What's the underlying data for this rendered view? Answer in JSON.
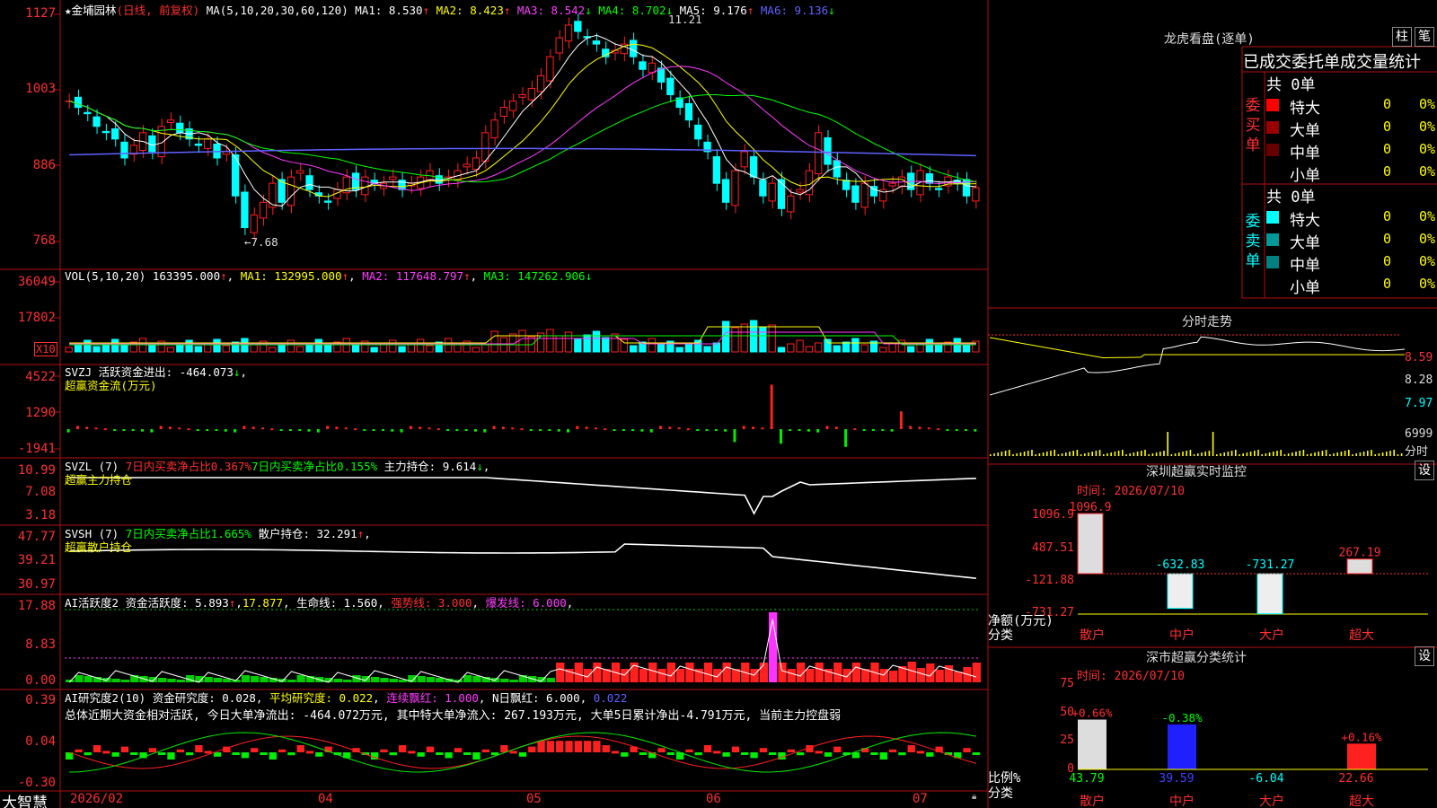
{
  "stock": {
    "name": "金埔园林",
    "mode": "(日线, 前复权)",
    "star": "★"
  },
  "ma_header": {
    "label": "MA(5,10,20,30,60,120)",
    "items": [
      {
        "name": "MA1:",
        "value": "8.530",
        "color": "#ffffff",
        "arrow": "↑",
        "arrow_color": "#ff3030"
      },
      {
        "name": "MA2:",
        "value": "8.423",
        "color": "#ffff00",
        "arrow": "↑",
        "arrow_color": "#ff3030"
      },
      {
        "name": "MA3:",
        "value": "8.542",
        "color": "#ff3cff",
        "arrow": "↓",
        "arrow_color": "#00ff00"
      },
      {
        "name": "MA4:",
        "value": "8.702",
        "color": "#00ff00",
        "arrow": "↓",
        "arrow_color": "#00ff00"
      },
      {
        "name": "MA5:",
        "value": "9.176",
        "color": "#ffffff",
        "arrow": "↑",
        "arrow_color": "#ff3030"
      },
      {
        "name": "MA6:",
        "value": "9.136",
        "color": "#6060ff",
        "arrow": "↓",
        "arrow_color": "#00ff00"
      }
    ]
  },
  "price_axis": [
    "1127",
    "1003",
    "886",
    "768"
  ],
  "price_annotations": {
    "high": "11.21",
    "low": "←7.68"
  },
  "vol": {
    "label": "VOL(5,10,20)",
    "value": "163395.000",
    "ma1": "MA1: 132995.000",
    "ma2": "MA2: 117648.797",
    "ma3": "MA3: 147262.906",
    "axis": [
      "36049",
      "17802"
    ],
    "unit": "X10"
  },
  "svzj": {
    "label": "SVZJ",
    "desc": "活跃资金进出: -464.073",
    "sub": "超赢资金流(万元)",
    "axis": [
      "4522",
      "1290",
      "-1941"
    ]
  },
  "svzl": {
    "label": "SVZL (7)",
    "t1": "7日内买卖净占比0.367%",
    "t2": "7日内买卖净占比0.155%",
    "t3": "主力持仓: 9.614",
    "sub": "超赢主力持仓",
    "axis": [
      "10.99",
      "7.08",
      "3.18"
    ]
  },
  "svsh": {
    "label": "SVSH (7)",
    "t1": "7日内买卖净占比1.665%",
    "t2": "散户持仓: 32.291",
    "sub": "超赢散户持仓",
    "axis": [
      "47.77",
      "39.21",
      "30.97"
    ]
  },
  "ai1": {
    "label": "AI活跃度2",
    "t1": "资金活跃度: 5.893",
    "t2": "17.877",
    "t3": "生命线: 1.560",
    "t4": "强势线: 3.000",
    "t5": "爆发线: 6.000",
    "axis": [
      "17.88",
      "8.83",
      "0.00"
    ]
  },
  "ai2": {
    "label": "AI研究度2(10)",
    "t1": "资金研究度: 0.028",
    "t2": "平均研究度: 0.022",
    "t3": "连续飘红: 1.000",
    "t4": "N日飘红: 6.000",
    "t5": "0.022",
    "summary": "总体近期大资金相对活跃, 今日大单净流出: -464.072万元, 其中特大单净流入: 267.193万元, 大单5日累计净出-4.791万元, 当前主力控盘弱",
    "axis": [
      "0.39",
      "0.04",
      "-0.30"
    ]
  },
  "time_axis": [
    "2026/02",
    "04",
    "05",
    "06",
    "07"
  ],
  "brand": "大智慧",
  "dragon": {
    "title": "龙虎看盘(逐单)",
    "btn1": "柱",
    "btn2": "笔",
    "tabs": "已成交委托单成交量统计",
    "buy_label": "委买单",
    "sell_label": "委卖单",
    "buy_total": "共 0单",
    "sell_total": "共 0单",
    "buy_rows": [
      {
        "name": "特大",
        "count": "0",
        "pct": "0%",
        "color": "#ff0000"
      },
      {
        "name": "大单",
        "count": "0",
        "pct": "0%",
        "color": "#990000"
      },
      {
        "name": "中单",
        "count": "0",
        "pct": "0%",
        "color": "#660000"
      },
      {
        "name": "小单",
        "count": "0",
        "pct": "0%",
        "color": ""
      }
    ],
    "sell_rows": [
      {
        "name": "特大",
        "count": "0",
        "pct": "0%",
        "color": "#00ffff"
      },
      {
        "name": "大单",
        "count": "0",
        "pct": "0%",
        "color": "#009999"
      },
      {
        "name": "中单",
        "count": "0",
        "pct": "0%",
        "color": "#008080"
      },
      {
        "name": "小单",
        "count": "0",
        "pct": "0%",
        "color": ""
      }
    ]
  },
  "intraday": {
    "title": "分时走势",
    "axis": [
      "8.59",
      "8.28",
      "7.97",
      "6999"
    ],
    "vol_label": "分时"
  },
  "monitor": {
    "title": "深圳超赢实时监控",
    "btn": "设",
    "time": "时间: 2026/07/10",
    "axis": [
      "1096.9",
      "487.51",
      "-121.88",
      "-731.27"
    ],
    "ylabel": "净额(万元)",
    "xlabel": "分类"
  },
  "classify": {
    "title": "深市超赢分类统计",
    "btn": "设",
    "time": "时间: 2026/07/10",
    "axis": [
      "75",
      "50",
      "25",
      "0"
    ],
    "ylabel": "比例%",
    "xlabel": "分类"
  },
  "chart_data": [
    {
      "type": "candlestick",
      "title": "金埔园林 (日线, 前复权)",
      "ylim": [
        7.4,
        11.4
      ],
      "annotations": [
        "11.21",
        "7.68"
      ],
      "series": [
        {
          "name": "MA1",
          "value": 8.53
        },
        {
          "name": "MA2",
          "value": 8.423
        },
        {
          "name": "MA3",
          "value": 8.542
        },
        {
          "name": "MA4",
          "value": 8.702
        },
        {
          "name": "MA5",
          "value": 9.176
        },
        {
          "name": "MA6",
          "value": 9.136
        }
      ],
      "close": [
        9.9,
        9.8,
        9.7,
        9.5,
        9.4,
        9.3,
        9.0,
        9.2,
        9.4,
        9.1,
        9.5,
        9.6,
        9.4,
        9.3,
        9.2,
        9.3,
        9.0,
        9.1,
        8.4,
        7.9,
        8.1,
        8.3,
        8.6,
        8.3,
        8.7,
        8.8,
        8.5,
        8.4,
        8.3,
        8.5,
        8.7,
        8.5,
        8.7,
        8.6,
        8.6,
        8.7,
        8.5,
        8.6,
        8.7,
        8.8,
        8.6,
        8.7,
        8.8,
        8.9,
        9.0,
        9.4,
        9.6,
        9.8,
        9.9,
        10.0,
        10.1,
        10.3,
        10.6,
        10.9,
        11.1,
        11.0,
        10.9,
        10.8,
        10.6,
        10.7,
        10.8,
        10.6,
        10.4,
        10.5,
        10.2,
        10.0,
        9.8,
        9.6,
        9.3,
        9.1,
        8.6,
        8.3,
        8.8,
        9.1,
        8.7,
        8.4,
        8.6,
        8.2,
        8.4,
        8.5,
        8.8,
        9.4,
        8.9,
        8.7,
        8.5,
        8.3,
        8.6,
        8.4,
        8.5,
        8.6,
        8.7,
        8.5,
        8.8,
        8.6,
        8.5,
        8.7,
        8.6,
        8.4,
        8.53
      ]
    },
    {
      "type": "bar",
      "title": "VOL(5,10,20)",
      "ylim": [
        0,
        36049
      ],
      "value": 163395.0,
      "series": [
        {
          "name": "MA1",
          "value": 132995.0
        },
        {
          "name": "MA2",
          "value": 117648.797
        },
        {
          "name": "MA3",
          "value": 147262.906
        }
      ]
    },
    {
      "type": "bar",
      "title": "活跃资金进出",
      "ylim": [
        -1941,
        4522
      ],
      "value": -464.073
    },
    {
      "type": "line",
      "title": "主力持仓",
      "ylim": [
        3.18,
        10.99
      ],
      "value": 9.614
    },
    {
      "type": "line",
      "title": "散户持仓",
      "ylim": [
        30.97,
        47.77
      ],
      "value": 32.291
    },
    {
      "type": "bar",
      "title": "资金活跃度",
      "ylim": [
        0,
        17.88
      ],
      "value": 5.893
    },
    {
      "type": "bar",
      "title": "资金研究度",
      "ylim": [
        -0.3,
        0.39
      ],
      "value": 0.028
    },
    {
      "type": "bar",
      "title": "深圳超赢实时监控",
      "categories": [
        "散户",
        "中户",
        "大户",
        "超大"
      ],
      "values": [
        1096.9,
        -632.83,
        -731.27,
        267.19
      ],
      "labels": [
        "1096.9",
        "-632.83",
        "-731.27",
        "267.19"
      ],
      "ylim": [
        -731.27,
        1096.9
      ]
    },
    {
      "type": "bar",
      "title": "深市超赢分类统计",
      "categories": [
        "散户",
        "中户",
        "大户",
        "超大"
      ],
      "values": [
        43.79,
        39.59,
        -6.04,
        22.66
      ],
      "changes": [
        "+0.66%",
        "-0.38%",
        "",
        "+0.16%"
      ],
      "labels": [
        "43.79",
        "39.59",
        "-6.04",
        "22.66"
      ],
      "ylim": [
        0,
        75
      ]
    }
  ]
}
